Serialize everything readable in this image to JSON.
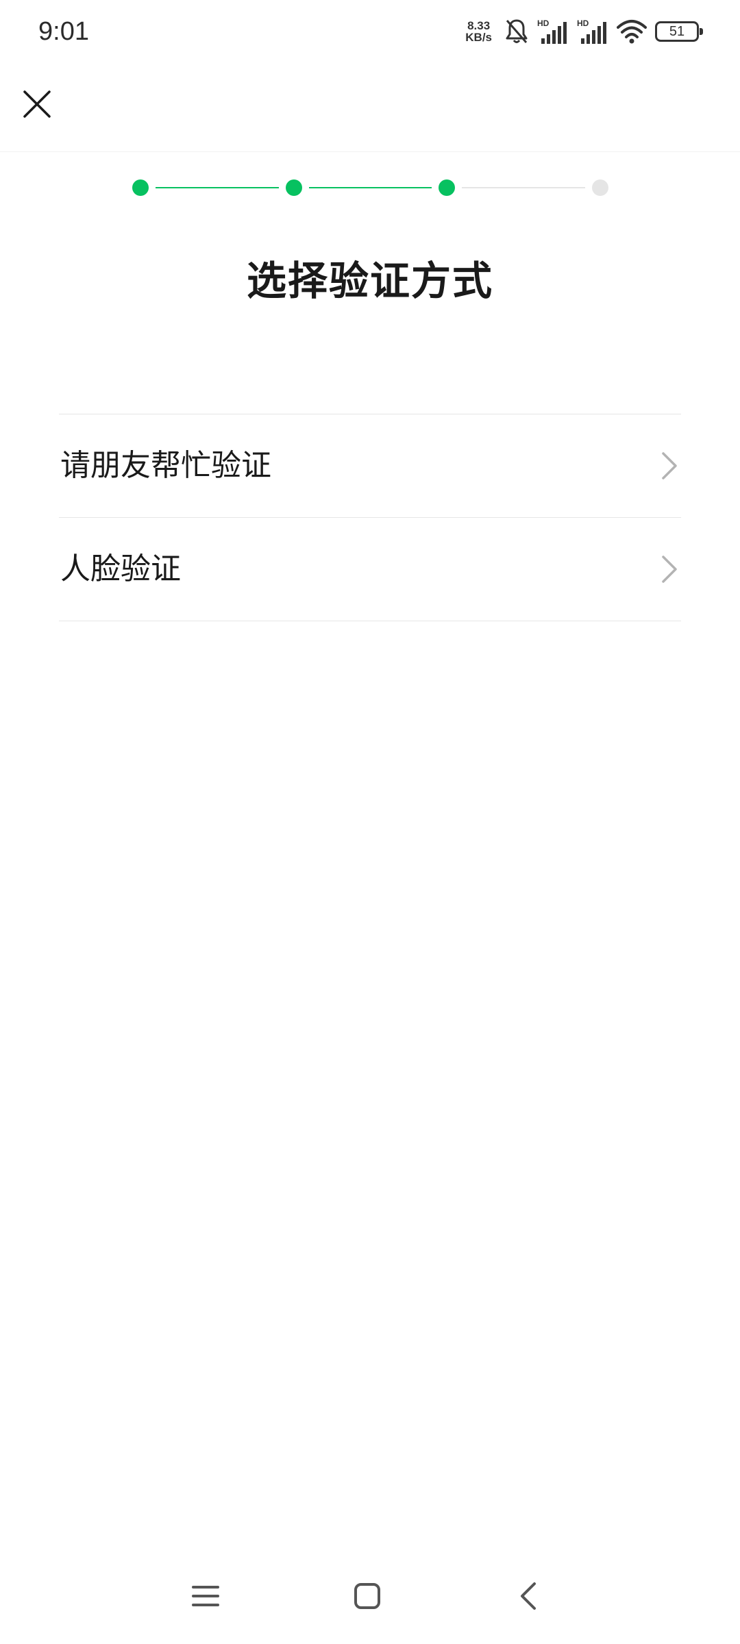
{
  "status_bar": {
    "time": "9:01",
    "net_speed_value": "8.33",
    "net_speed_unit": "KB/s",
    "hd_label_1": "HD",
    "hd_label_2": "HD",
    "battery_level": "51",
    "icons": [
      "bell-muted-icon",
      "signal-icon",
      "signal-icon",
      "wifi-icon",
      "battery-icon"
    ]
  },
  "nav": {
    "close_icon": "close-icon"
  },
  "progress": {
    "total_steps": 4,
    "current_step": 3,
    "active_color": "#07c160",
    "inactive_color": "#e5e5e5"
  },
  "title": "选择验证方式",
  "options": [
    {
      "label": "请朋友帮忙验证",
      "icon": "chevron-right-icon"
    },
    {
      "label": "人脸验证",
      "icon": "chevron-right-icon"
    }
  ],
  "system_nav": {
    "menu_icon": "menu-icon",
    "home_icon": "home-icon",
    "back_icon": "back-icon"
  }
}
